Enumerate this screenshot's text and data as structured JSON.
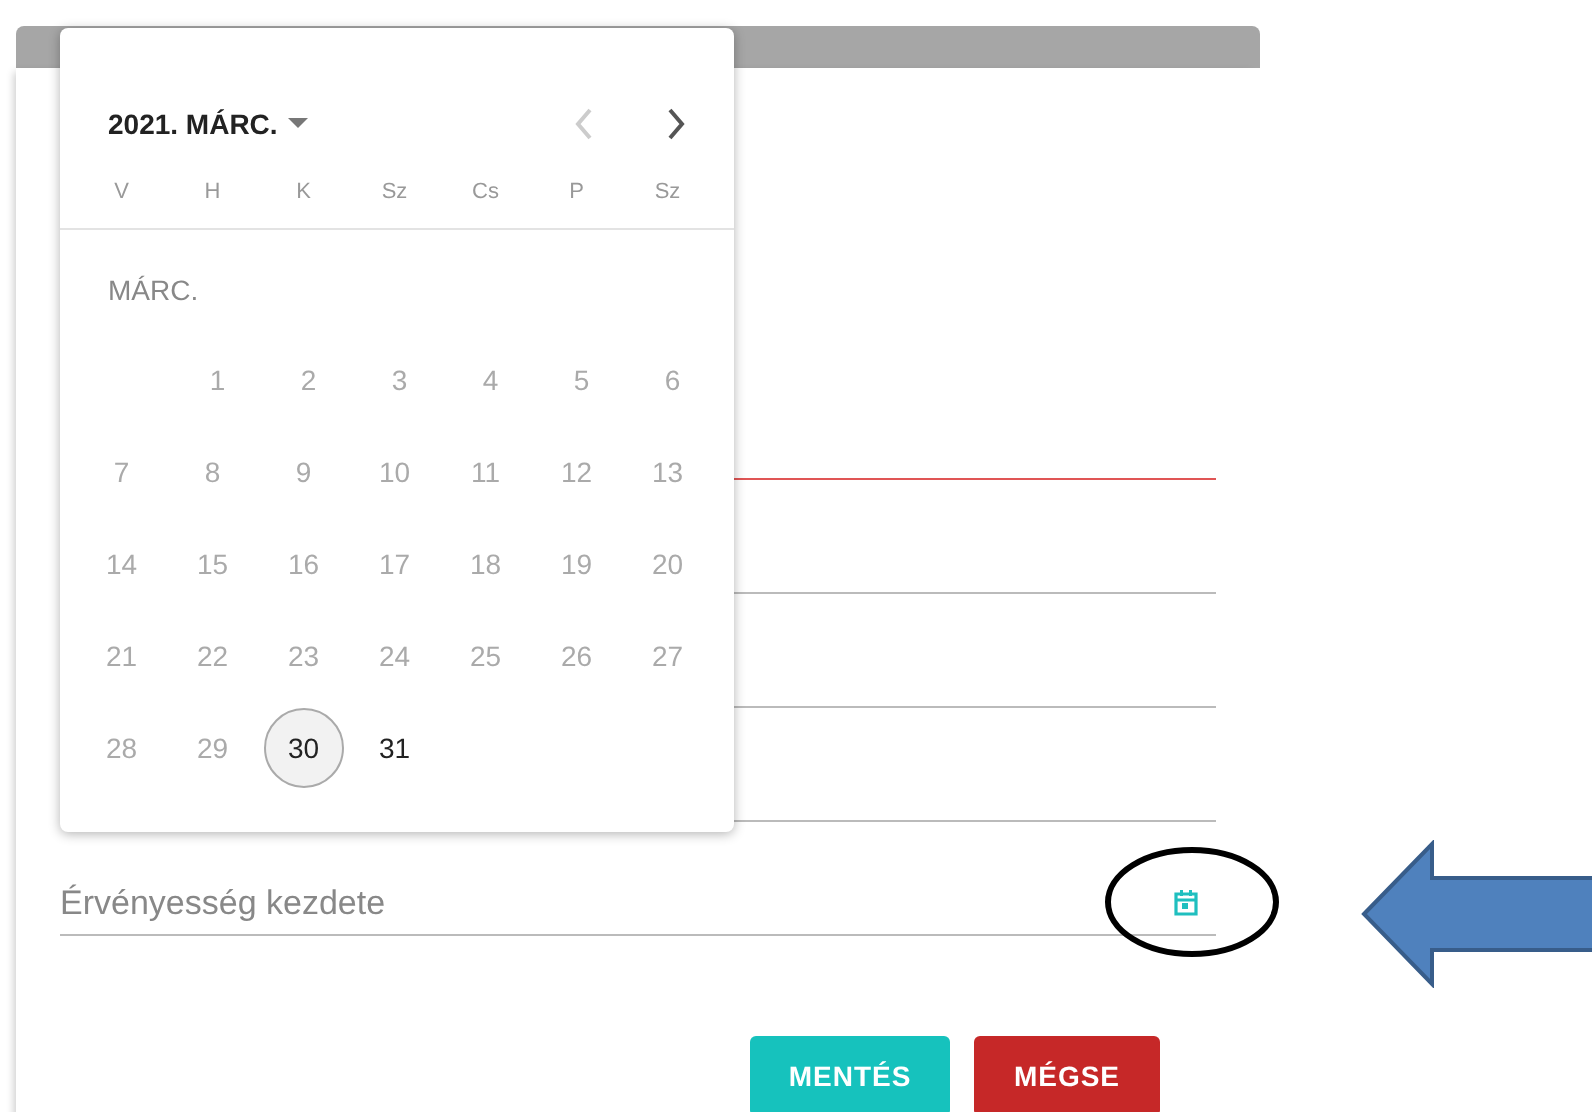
{
  "form": {
    "fields": [
      {
        "error": true
      },
      {
        "error": false
      },
      {
        "error": false
      },
      {
        "error": false
      },
      {
        "placeholder": "Érvényesség kezdete",
        "error": false
      }
    ],
    "buttons": [
      {
        "label": "MENTÉS",
        "kind": "primary"
      },
      {
        "label": "MÉGSE",
        "kind": "danger"
      }
    ]
  },
  "datepicker": {
    "title": "2021. MÁRC.",
    "weekdays": [
      "V",
      "H",
      "K",
      "Sz",
      "Cs",
      "P",
      "Sz"
    ],
    "month_label": "MÁRC.",
    "weeks": [
      [
        {
          "label": "1",
          "disabled": true,
          "selected": false
        },
        {
          "label": "2",
          "disabled": true,
          "selected": false
        },
        {
          "label": "3",
          "disabled": true,
          "selected": false
        },
        {
          "label": "4",
          "disabled": true,
          "selected": false
        },
        {
          "label": "5",
          "disabled": true,
          "selected": false
        },
        {
          "label": "6",
          "disabled": true,
          "selected": false
        }
      ],
      [
        {
          "label": "7",
          "disabled": true,
          "selected": false
        },
        {
          "label": "8",
          "disabled": true,
          "selected": false
        },
        {
          "label": "9",
          "disabled": true,
          "selected": false
        },
        {
          "label": "10",
          "disabled": true,
          "selected": false
        },
        {
          "label": "11",
          "disabled": true,
          "selected": false
        },
        {
          "label": "12",
          "disabled": true,
          "selected": false
        },
        {
          "label": "13",
          "disabled": true,
          "selected": false
        }
      ],
      [
        {
          "label": "14",
          "disabled": true,
          "selected": false
        },
        {
          "label": "15",
          "disabled": true,
          "selected": false
        },
        {
          "label": "16",
          "disabled": true,
          "selected": false
        },
        {
          "label": "17",
          "disabled": true,
          "selected": false
        },
        {
          "label": "18",
          "disabled": true,
          "selected": false
        },
        {
          "label": "19",
          "disabled": true,
          "selected": false
        },
        {
          "label": "20",
          "disabled": true,
          "selected": false
        }
      ],
      [
        {
          "label": "21",
          "disabled": true,
          "selected": false
        },
        {
          "label": "22",
          "disabled": true,
          "selected": false
        },
        {
          "label": "23",
          "disabled": true,
          "selected": false
        },
        {
          "label": "24",
          "disabled": true,
          "selected": false
        },
        {
          "label": "25",
          "disabled": true,
          "selected": false
        },
        {
          "label": "26",
          "disabled": true,
          "selected": false
        },
        {
          "label": "27",
          "disabled": true,
          "selected": false
        }
      ],
      [
        {
          "label": "28",
          "disabled": true,
          "selected": false
        },
        {
          "label": "29",
          "disabled": true,
          "selected": false
        },
        {
          "label": "30",
          "disabled": false,
          "selected": true
        },
        {
          "label": "31",
          "disabled": false,
          "selected": false
        }
      ]
    ]
  }
}
